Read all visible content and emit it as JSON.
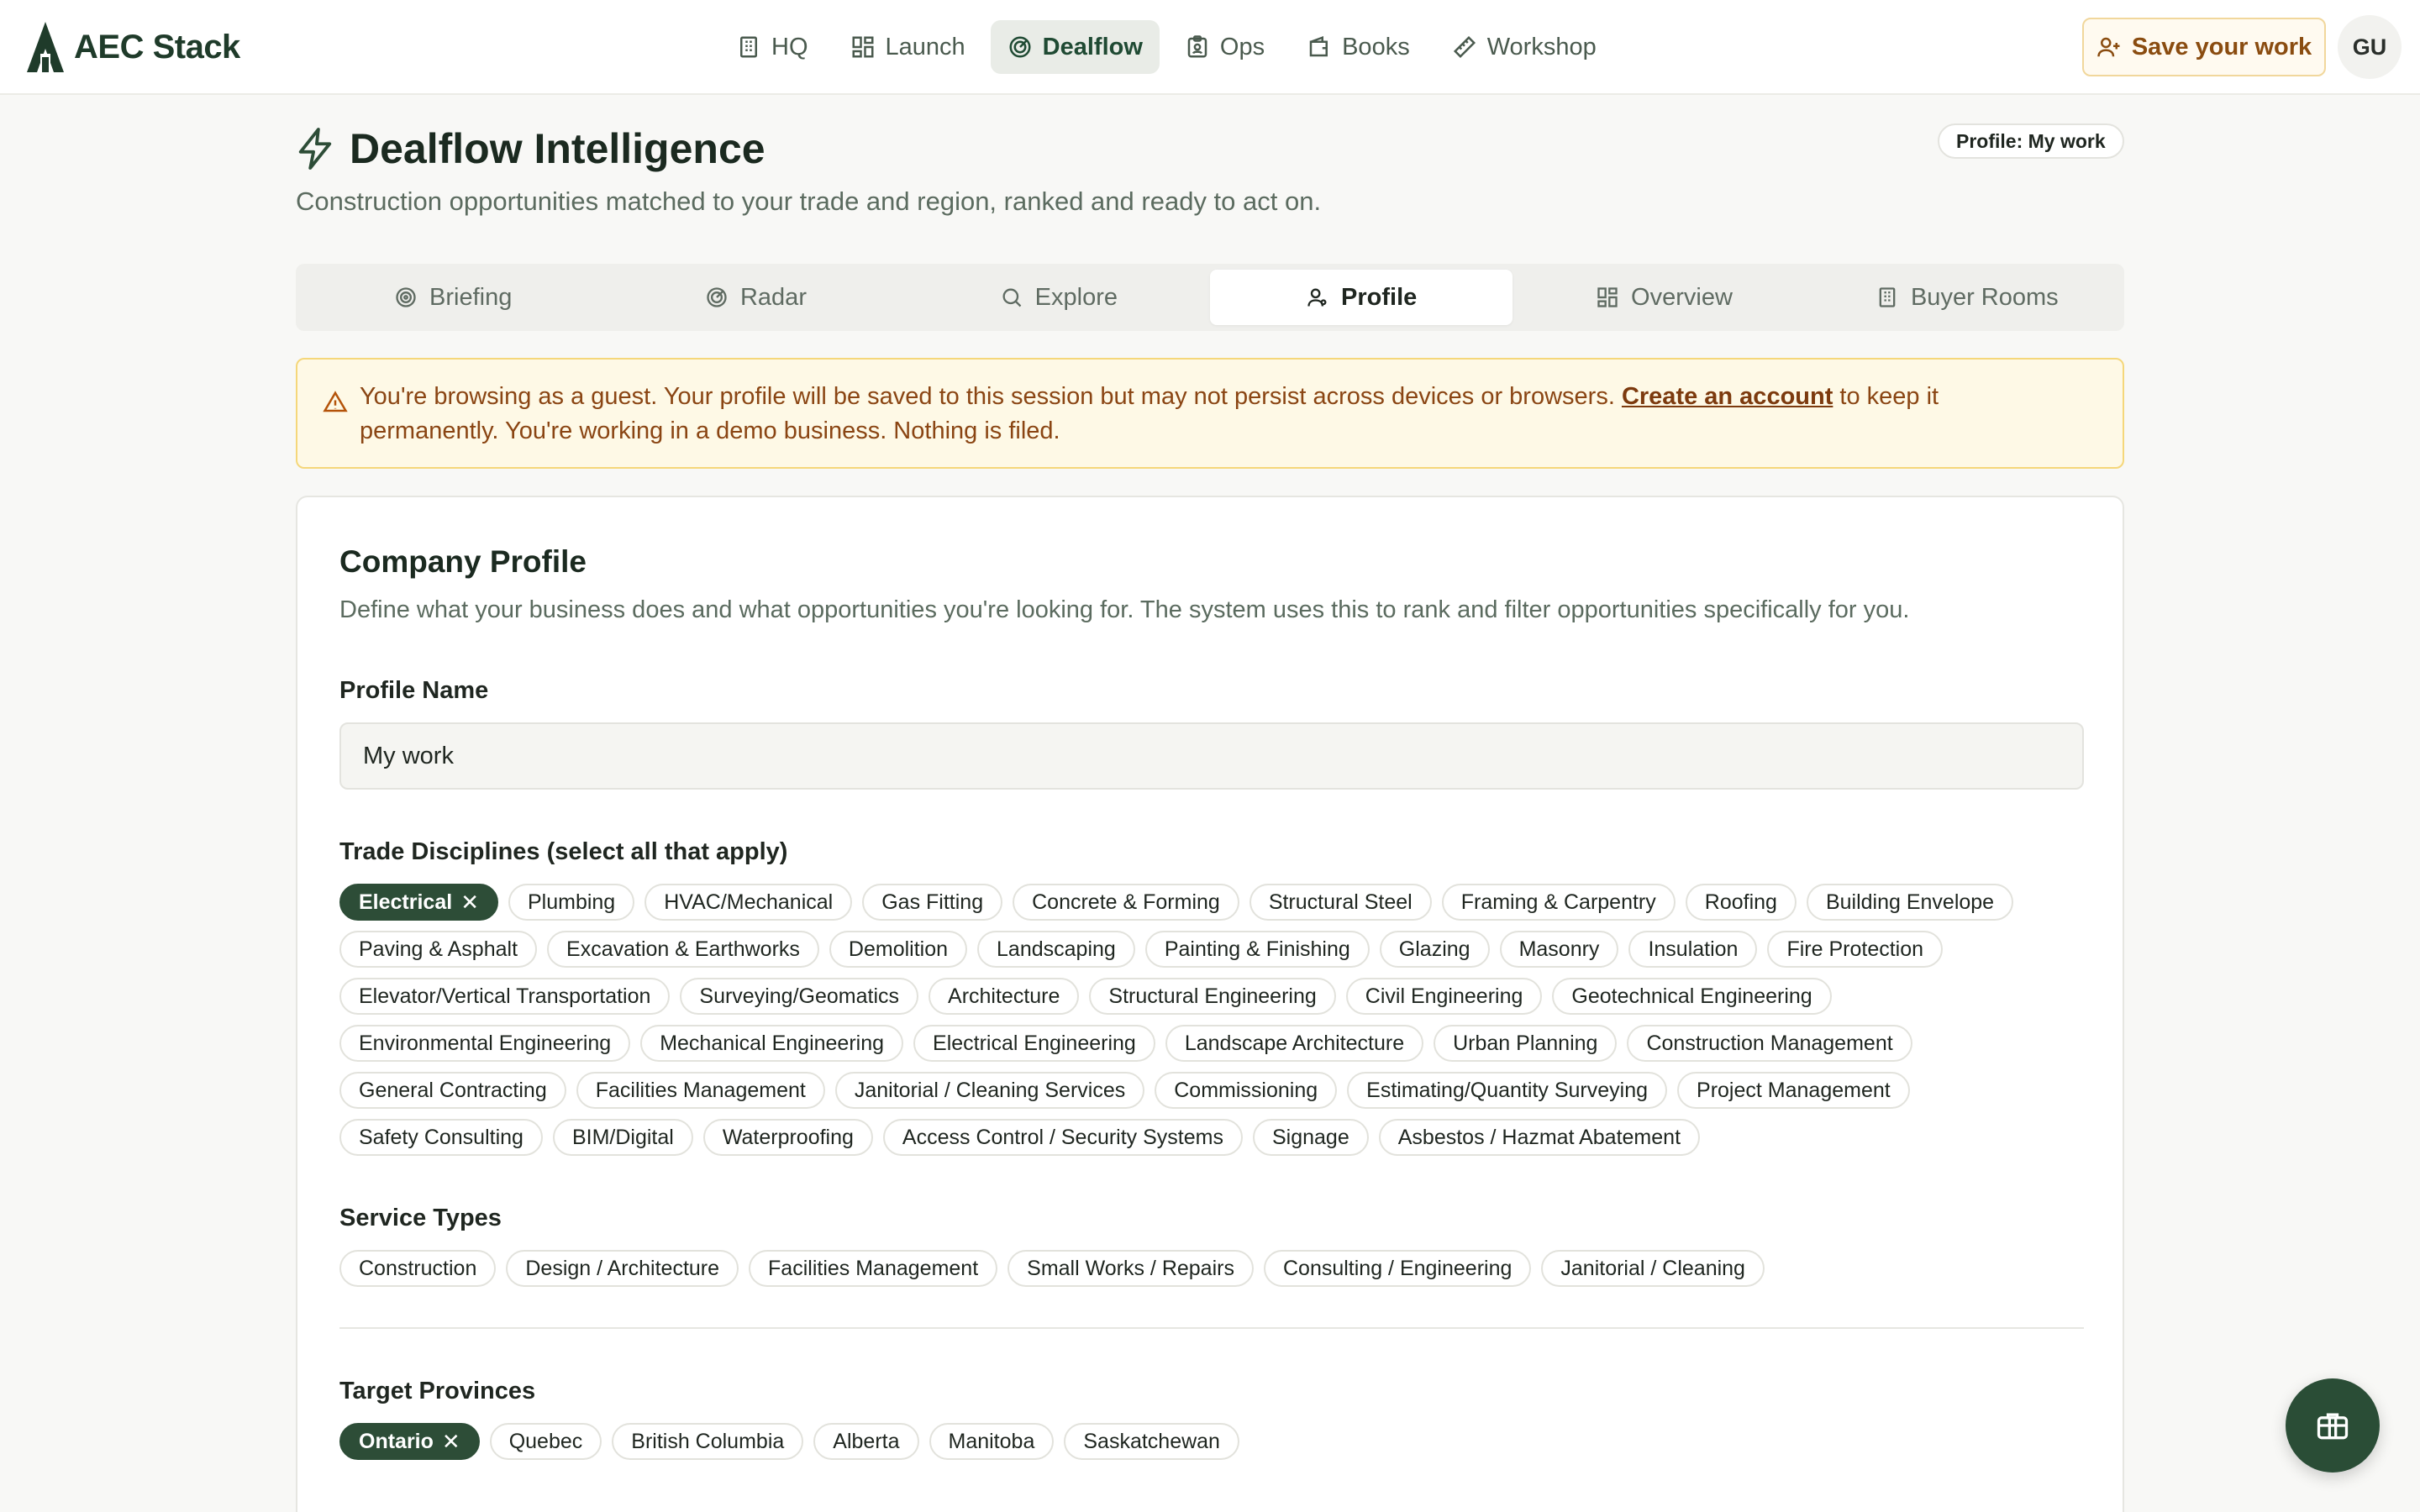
{
  "brand": {
    "name": "AEC Stack"
  },
  "nav": {
    "items": [
      {
        "label": "HQ",
        "icon": "building-icon"
      },
      {
        "label": "Launch",
        "icon": "grid-icon"
      },
      {
        "label": "Dealflow",
        "icon": "radar-icon",
        "active": true
      },
      {
        "label": "Ops",
        "icon": "clipboard-icon"
      },
      {
        "label": "Books",
        "icon": "wallet-icon"
      },
      {
        "label": "Workshop",
        "icon": "ruler-icon"
      }
    ],
    "save_label": "Save your work",
    "avatar_initials": "GU"
  },
  "header": {
    "title": "Dealflow Intelligence",
    "subtitle": "Construction opportunities matched to your trade and region, ranked and ready to act on.",
    "profile_badge": "Profile: My work"
  },
  "tabs": [
    {
      "label": "Briefing",
      "icon": "target-icon"
    },
    {
      "label": "Radar",
      "icon": "radar-icon"
    },
    {
      "label": "Explore",
      "icon": "search-icon"
    },
    {
      "label": "Profile",
      "icon": "user-icon",
      "active": true
    },
    {
      "label": "Overview",
      "icon": "grid-icon"
    },
    {
      "label": "Buyer Rooms",
      "icon": "building-icon"
    }
  ],
  "alert": {
    "text_before": "You're browsing as a guest. Your profile will be saved to this session but may not persist across devices or browsers. ",
    "link": "Create an account",
    "text_after": " to keep it permanently. You're working in a demo business. Nothing is filed."
  },
  "profile": {
    "title": "Company Profile",
    "description": "Define what your business does and what opportunities you're looking for. The system uses this to rank and filter opportunities specifically for you.",
    "name_label": "Profile Name",
    "name_value": "My work",
    "trades_label": "Trade Disciplines (select all that apply)",
    "trades": [
      {
        "label": "Electrical",
        "selected": true
      },
      {
        "label": "Plumbing"
      },
      {
        "label": "HVAC/Mechanical"
      },
      {
        "label": "Gas Fitting"
      },
      {
        "label": "Concrete & Forming"
      },
      {
        "label": "Structural Steel"
      },
      {
        "label": "Framing & Carpentry"
      },
      {
        "label": "Roofing"
      },
      {
        "label": "Building Envelope"
      },
      {
        "label": "Paving & Asphalt"
      },
      {
        "label": "Excavation & Earthworks"
      },
      {
        "label": "Demolition"
      },
      {
        "label": "Landscaping"
      },
      {
        "label": "Painting & Finishing"
      },
      {
        "label": "Glazing"
      },
      {
        "label": "Masonry"
      },
      {
        "label": "Insulation"
      },
      {
        "label": "Fire Protection"
      },
      {
        "label": "Elevator/Vertical Transportation"
      },
      {
        "label": "Surveying/Geomatics"
      },
      {
        "label": "Architecture"
      },
      {
        "label": "Structural Engineering"
      },
      {
        "label": "Civil Engineering"
      },
      {
        "label": "Geotechnical Engineering"
      },
      {
        "label": "Environmental Engineering"
      },
      {
        "label": "Mechanical Engineering"
      },
      {
        "label": "Electrical Engineering"
      },
      {
        "label": "Landscape Architecture"
      },
      {
        "label": "Urban Planning"
      },
      {
        "label": "Construction Management"
      },
      {
        "label": "General Contracting"
      },
      {
        "label": "Facilities Management"
      },
      {
        "label": "Janitorial / Cleaning Services"
      },
      {
        "label": "Commissioning"
      },
      {
        "label": "Estimating/Quantity Surveying"
      },
      {
        "label": "Project Management"
      },
      {
        "label": "Safety Consulting"
      },
      {
        "label": "BIM/Digital"
      },
      {
        "label": "Waterproofing"
      },
      {
        "label": "Access Control / Security Systems"
      },
      {
        "label": "Signage"
      },
      {
        "label": "Asbestos / Hazmat Abatement"
      }
    ],
    "services_label": "Service Types",
    "services": [
      {
        "label": "Construction"
      },
      {
        "label": "Design / Architecture"
      },
      {
        "label": "Facilities Management"
      },
      {
        "label": "Small Works / Repairs"
      },
      {
        "label": "Consulting / Engineering"
      },
      {
        "label": "Janitorial / Cleaning"
      }
    ],
    "provinces_label": "Target Provinces",
    "provinces": [
      {
        "label": "Ontario",
        "selected": true
      },
      {
        "label": "Quebec"
      },
      {
        "label": "British Columbia"
      },
      {
        "label": "Alberta"
      },
      {
        "label": "Manitoba"
      },
      {
        "label": "Saskatchewan"
      }
    ]
  },
  "colors": {
    "brand_green": "#2d4d37",
    "warning_bg": "#fef9e6",
    "warning_text": "#8a4513",
    "save_accent": "#8a4c10"
  }
}
